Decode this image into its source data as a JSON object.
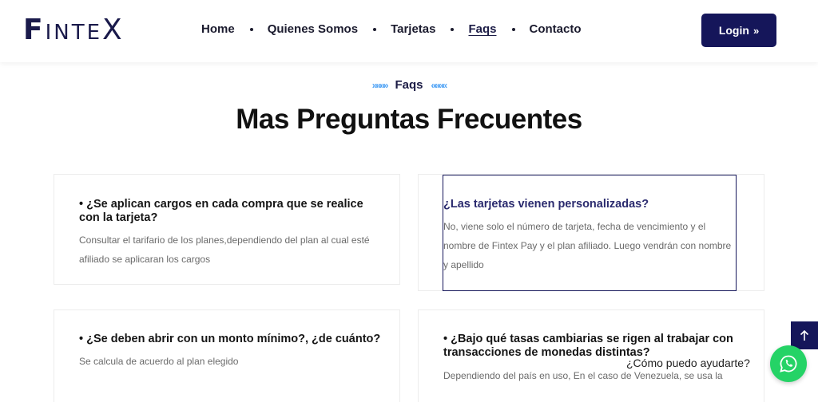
{
  "brand": {
    "logo_f": "F",
    "logo_inte": "INTE",
    "logo_x": "X"
  },
  "nav": {
    "items": [
      {
        "label": "Home"
      },
      {
        "label": "Quienes Somos"
      },
      {
        "label": "Tarjetas"
      },
      {
        "label": "Faqs"
      },
      {
        "label": "Contacto"
      }
    ],
    "login_label": "Login",
    "login_icon": "»"
  },
  "section": {
    "eyebrow": "Faqs",
    "eyebrow_left_arrows": "»»»»",
    "eyebrow_right_arrows": "««««",
    "title": "Mas Preguntas Frecuentes"
  },
  "faqs": [
    {
      "question": "• ¿Se aplican cargos en cada compra que se realice con la tarjeta?",
      "answer": "Consultar el tarifario de los planes,dependiendo del plan al cual esté afiliado se aplicaran los cargos"
    },
    {
      "question": "¿Las tarjetas vienen personalizadas?",
      "answer": "No, viene solo el número de tarjeta, fecha de vencimiento y el nombre de Fintex Pay y el plan afiliado. Luego vendrán con nombre y apellido"
    },
    {
      "question": "• ¿Se deben abrir con un monto mínimo?, ¿de cuánto?",
      "answer": "Se calcula de acuerdo al plan elegido"
    },
    {
      "question": "• ¿Bajo qué tasas cambiarias se rigen al trabajar con transacciones de monedas distintas?",
      "answer": "Dependiendo del país en uso, En el caso de Venezuela, se usa la"
    }
  ],
  "chat": {
    "help_text": "¿Cómo puedo ayudarte?"
  },
  "colors": {
    "primary": "#15165a",
    "accent": "#4aa0f5",
    "whatsapp": "#25d366"
  }
}
